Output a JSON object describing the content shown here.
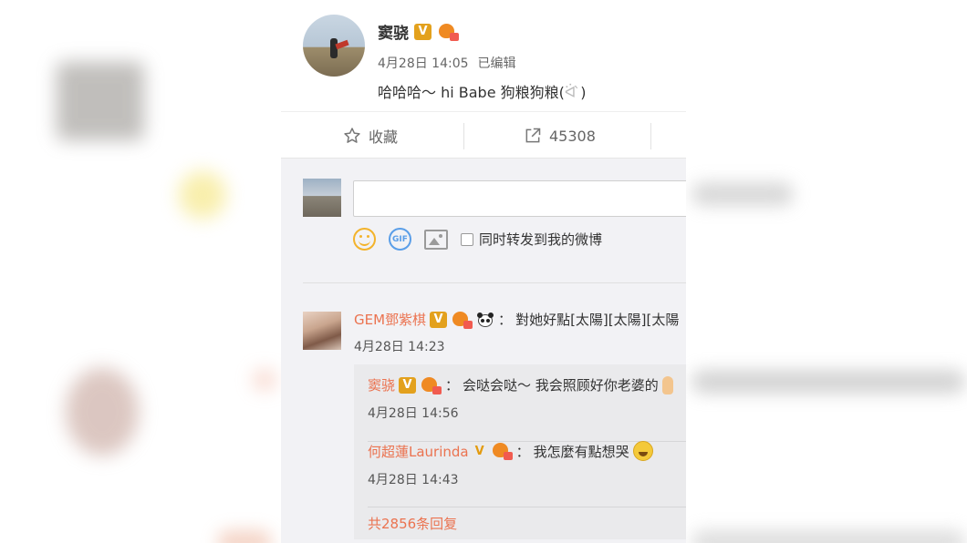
{
  "post": {
    "author": "窦骁",
    "timestamp": "4月28日 14:05",
    "edited_label": "已编辑",
    "content": "哈哈哈～ hi Babe 狗粮狗粮(",
    "content_emoji": "ᐛ ̀",
    "content_close": ")",
    "verified_badge": "V"
  },
  "actions": {
    "favorite_label": "收藏",
    "favorite_icon": "star-outline-icon",
    "forward_count": "45308",
    "forward_icon": "share-arrow-icon"
  },
  "composer": {
    "input_value": "",
    "input_placeholder": "",
    "emoji_icon": "smiley-icon",
    "gif_label": "GIF",
    "image_icon": "image-icon",
    "repost_checkbox_label": "同时转发到我的微博",
    "repost_checked": false
  },
  "comment": {
    "user": "GEM鄧紫棋",
    "verified_badge": "V",
    "separator": "：",
    "text": "對她好點[太陽][太陽][太陽",
    "time": "4月28日 14:23"
  },
  "replies": [
    {
      "user": "窦骁",
      "verified_badge": "V",
      "separator": "：",
      "text": "会哒会哒～ 我会照顾好你老婆的",
      "time": "4月28日 14:56"
    },
    {
      "user": "何超蓮Laurinda",
      "verified_badge": "V",
      "separator": "：",
      "text": "我怎麼有點想哭",
      "time": "4月28日 14:43"
    }
  ],
  "replies_total_label": "共2856条回复",
  "colors": {
    "accent_link": "#eb7350",
    "badge_gold": "#e3a11d",
    "comment_bg": "#f2f2f5"
  }
}
